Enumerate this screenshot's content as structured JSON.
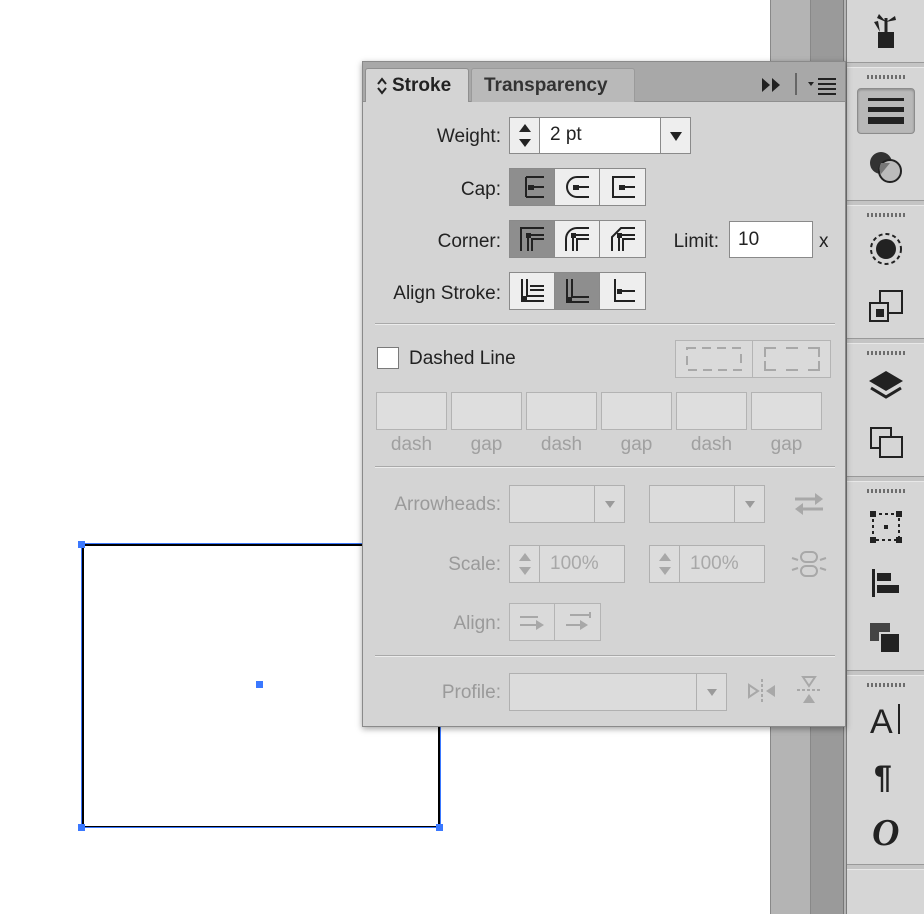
{
  "panel": {
    "tabs": [
      {
        "label": "Stroke",
        "active": true
      },
      {
        "label": "Transparency",
        "active": false
      }
    ],
    "weight": {
      "label": "Weight:",
      "value": "2 pt"
    },
    "cap": {
      "label": "Cap:",
      "options": [
        "butt-cap-icon",
        "round-cap-icon",
        "projecting-cap-icon"
      ],
      "selected": 0
    },
    "corner": {
      "label": "Corner:",
      "options": [
        "miter-join-icon",
        "round-join-icon",
        "bevel-join-icon"
      ],
      "selected": 0,
      "limit_label": "Limit:",
      "limit_value": "10",
      "limit_suffix": "x"
    },
    "align_stroke": {
      "label": "Align Stroke:",
      "options": [
        "align-center-icon",
        "align-inside-icon",
        "align-outside-icon"
      ],
      "selected": 1
    },
    "dashed_line": {
      "label": "Dashed Line",
      "checked": false
    },
    "dash_gap_labels": [
      "dash",
      "gap",
      "dash",
      "gap",
      "dash",
      "gap"
    ],
    "arrowheads": {
      "label": "Arrowheads:"
    },
    "scale": {
      "label": "Scale:",
      "start": "100%",
      "end": "100%"
    },
    "align": {
      "label": "Align:"
    },
    "profile": {
      "label": "Profile:"
    }
  },
  "colors": {
    "selection": "#3a78ff",
    "panel_bg": "#d4d4d4",
    "titlebar_bg": "#a8a8a8",
    "selected_segment": "#8e8e8e"
  }
}
